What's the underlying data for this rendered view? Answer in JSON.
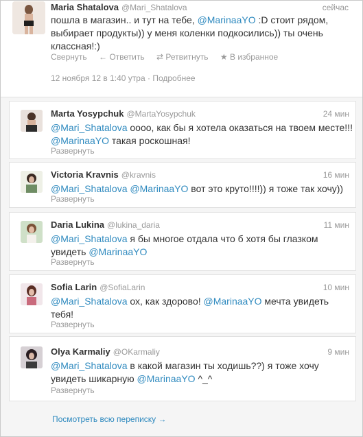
{
  "main_tweet": {
    "fullname": "Maria Shatalova",
    "username": "@Mari_Shatalova",
    "time": "сейчас",
    "text_parts": [
      {
        "t": "пошла в магазин.. и тут на тебе, ",
        "m": false
      },
      {
        "t": "@MarinaaYO",
        "m": true
      },
      {
        "t": " :D стоит рядом, выбирает продукты)) у меня коленки подкосились)) ты очень классная!:)",
        "m": false
      }
    ],
    "actions": [
      "Свернуть",
      "← Ответить",
      "⇄ Ретвитнуть",
      "★ В избранное"
    ],
    "date": "12 ноября 12 в 1:40 утра",
    "details": "Подробнее"
  },
  "replies": [
    {
      "fullname": "Marta Yosypchuk",
      "username": "@MartaYosypchuk",
      "time": "24 мин",
      "text_parts": [
        {
          "t": "@Mari_Shatalova",
          "m": true
        },
        {
          "t": " оооо, как бы я хотела оказаться на твоем месте!!! ",
          "m": false
        },
        {
          "t": "@MarinaaYO",
          "m": true
        },
        {
          "t": " такая роскошная!",
          "m": false
        }
      ],
      "expand": "Развернуть"
    },
    {
      "fullname": "Victoria Kravnis",
      "username": "@kravnis",
      "time": "16 мин",
      "text_parts": [
        {
          "t": "@Mari_Shatalova",
          "m": true
        },
        {
          "t": " ",
          "m": false
        },
        {
          "t": "@MarinaaYO",
          "m": true
        },
        {
          "t": " вот это круто!!!!)) я тоже так хочу))",
          "m": false
        }
      ],
      "expand": "Развернуть"
    },
    {
      "fullname": "Daria Lukina",
      "username": "@lukina_daria",
      "time": "11 мин",
      "text_parts": [
        {
          "t": "@Mari_Shatalova",
          "m": true
        },
        {
          "t": " я бы многое отдала что б хотя бы глазком увидеть ",
          "m": false
        },
        {
          "t": "@MarinaaYO",
          "m": true
        }
      ],
      "expand": "Развернуть"
    },
    {
      "fullname": "Sofia Larin",
      "username": "@SofiaLarin",
      "time": "10 мин",
      "text_parts": [
        {
          "t": "@Mari_Shatalova",
          "m": true
        },
        {
          "t": " ох, как здорово! ",
          "m": false
        },
        {
          "t": "@MarinaaYO",
          "m": true
        },
        {
          "t": " мечта увидеть тебя!",
          "m": false
        }
      ],
      "expand": "Развернуть"
    },
    {
      "fullname": "Olya Karmaliy",
      "username": "@OKarmaliy",
      "time": "9 мин",
      "text_parts": [
        {
          "t": "@Mari_Shatalova",
          "m": true
        },
        {
          "t": " в какой магазин ты ходишь??) я тоже хочу увидеть шикарную ",
          "m": false
        },
        {
          "t": "@MarinaaYO",
          "m": true
        },
        {
          "t": " ^_^",
          "m": false
        }
      ],
      "expand": "Развернуть"
    }
  ],
  "see_all": "Посмотреть всю переписку →"
}
